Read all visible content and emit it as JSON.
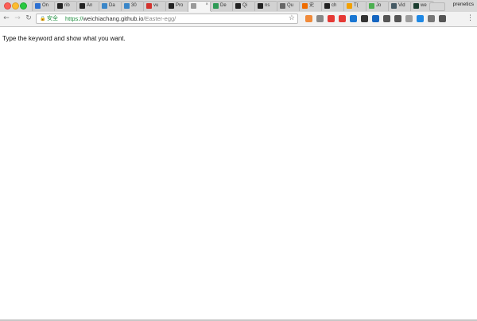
{
  "browser": {
    "tabs": [
      {
        "label": "On",
        "icon": "vue-icon",
        "color": "#2c6fd1"
      },
      {
        "label": "rib",
        "icon": "github-icon",
        "color": "#222222"
      },
      {
        "label": "An",
        "icon": "github-icon",
        "color": "#222222"
      },
      {
        "label": "Da",
        "icon": "image-icon",
        "color": "#3a86c8"
      },
      {
        "label": "30",
        "icon": "image-icon",
        "color": "#3a86c8"
      },
      {
        "label": "vu",
        "icon": "red-square-icon",
        "color": "#d2322d"
      },
      {
        "label": "Pro",
        "icon": "github-icon",
        "color": "#222222"
      },
      {
        "label": "",
        "icon": "page-icon",
        "color": "#9a9a9a",
        "active": true
      },
      {
        "label": "De",
        "icon": "cloud-icon",
        "color": "#2e9a55"
      },
      {
        "label": "Qi",
        "icon": "github-icon",
        "color": "#222222"
      },
      {
        "label": "ns",
        "icon": "github-icon",
        "color": "#222222"
      },
      {
        "label": "Qu",
        "icon": "code-icon",
        "color": "#666666"
      },
      {
        "label": "史",
        "icon": "orange-icon",
        "color": "#ef6c00"
      },
      {
        "label": "ch",
        "icon": "github-icon",
        "color": "#222222"
      },
      {
        "label": "T(",
        "icon": "orange-c-icon",
        "color": "#f2a000"
      },
      {
        "label": "Jo",
        "icon": "map-icon",
        "color": "#4caf50"
      },
      {
        "label": "Vid",
        "icon": "monitor-icon",
        "color": "#455a64"
      },
      {
        "label": "we",
        "icon": "dark-green-icon",
        "color": "#1b3d2f"
      }
    ],
    "profile": "prenetics",
    "secure_label": "安全",
    "url_scheme": "https://",
    "url_host": "weichiachang.github.io",
    "url_path": "/Easter-egg/",
    "extensions": [
      {
        "icon": "swoosh-icon",
        "color": "#f08a3a"
      },
      {
        "icon": "xx-icon",
        "color": "#888888"
      },
      {
        "icon": "abp-icon",
        "color": "#e53935"
      },
      {
        "icon": "opera-icon",
        "color": "#e53935"
      },
      {
        "icon": "wave-icon",
        "color": "#1976d2"
      },
      {
        "icon": "flask-icon",
        "color": "#333333"
      },
      {
        "icon": "vue-ext-icon",
        "color": "#1565c0"
      },
      {
        "icon": "grid-icon",
        "color": "#555555"
      },
      {
        "icon": "a-icon",
        "color": "#555555"
      },
      {
        "icon": "box-icon",
        "color": "#9e9e9e"
      },
      {
        "icon": "s-icon",
        "color": "#1e88e5"
      },
      {
        "icon": "gear-ext-icon",
        "color": "#777777"
      },
      {
        "icon": "ghost-icon",
        "color": "#555555"
      }
    ]
  },
  "page": {
    "text": "Type the keyword and show what you want."
  }
}
